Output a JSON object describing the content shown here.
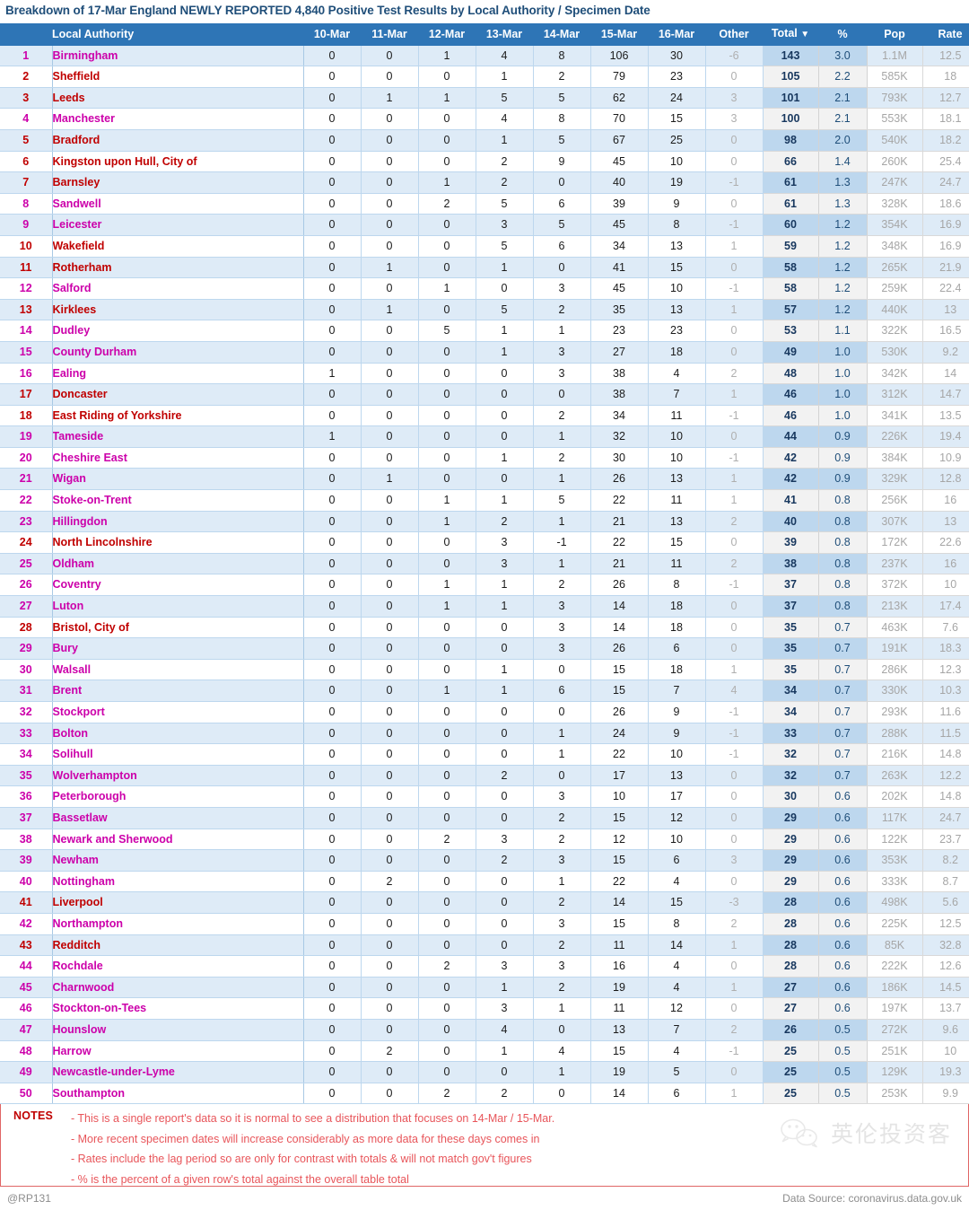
{
  "title": "Breakdown of 17-Mar England NEWLY REPORTED 4,840 Positive Test Results by Local Authority / Specimen Date",
  "table": {
    "columns": {
      "rank": "",
      "local_authority": "Local Authority",
      "days": [
        "10-Mar",
        "11-Mar",
        "12-Mar",
        "13-Mar",
        "14-Mar",
        "15-Mar",
        "16-Mar"
      ],
      "other": "Other",
      "total": "Total",
      "total_sort_icon": "▼",
      "percent": "%",
      "pop": "Pop",
      "rate": "Rate"
    },
    "rows": [
      {
        "rank": "1",
        "name": "Birmingham",
        "color": "magenta",
        "days": [
          "0",
          "0",
          "1",
          "4",
          "8",
          "106",
          "30"
        ],
        "other": "-6",
        "total": "143",
        "pct": "3.0",
        "pop": "1.1M",
        "rate": "12.5"
      },
      {
        "rank": "2",
        "name": "Sheffield",
        "color": "red",
        "days": [
          "0",
          "0",
          "0",
          "1",
          "2",
          "79",
          "23"
        ],
        "other": "0",
        "total": "105",
        "pct": "2.2",
        "pop": "585K",
        "rate": "18"
      },
      {
        "rank": "3",
        "name": "Leeds",
        "color": "red",
        "days": [
          "0",
          "1",
          "1",
          "5",
          "5",
          "62",
          "24"
        ],
        "other": "3",
        "total": "101",
        "pct": "2.1",
        "pop": "793K",
        "rate": "12.7"
      },
      {
        "rank": "4",
        "name": "Manchester",
        "color": "magenta",
        "days": [
          "0",
          "0",
          "0",
          "4",
          "8",
          "70",
          "15"
        ],
        "other": "3",
        "total": "100",
        "pct": "2.1",
        "pop": "553K",
        "rate": "18.1"
      },
      {
        "rank": "5",
        "name": "Bradford",
        "color": "red",
        "days": [
          "0",
          "0",
          "0",
          "1",
          "5",
          "67",
          "25"
        ],
        "other": "0",
        "total": "98",
        "pct": "2.0",
        "pop": "540K",
        "rate": "18.2"
      },
      {
        "rank": "6",
        "name": "Kingston upon Hull, City of",
        "color": "red",
        "days": [
          "0",
          "0",
          "0",
          "2",
          "9",
          "45",
          "10"
        ],
        "other": "0",
        "total": "66",
        "pct": "1.4",
        "pop": "260K",
        "rate": "25.4"
      },
      {
        "rank": "7",
        "name": "Barnsley",
        "color": "red",
        "days": [
          "0",
          "0",
          "1",
          "2",
          "0",
          "40",
          "19"
        ],
        "other": "-1",
        "total": "61",
        "pct": "1.3",
        "pop": "247K",
        "rate": "24.7"
      },
      {
        "rank": "8",
        "name": "Sandwell",
        "color": "magenta",
        "days": [
          "0",
          "0",
          "2",
          "5",
          "6",
          "39",
          "9"
        ],
        "other": "0",
        "total": "61",
        "pct": "1.3",
        "pop": "328K",
        "rate": "18.6"
      },
      {
        "rank": "9",
        "name": "Leicester",
        "color": "magenta",
        "days": [
          "0",
          "0",
          "0",
          "3",
          "5",
          "45",
          "8"
        ],
        "other": "-1",
        "total": "60",
        "pct": "1.2",
        "pop": "354K",
        "rate": "16.9"
      },
      {
        "rank": "10",
        "name": "Wakefield",
        "color": "red",
        "days": [
          "0",
          "0",
          "0",
          "5",
          "6",
          "34",
          "13"
        ],
        "other": "1",
        "total": "59",
        "pct": "1.2",
        "pop": "348K",
        "rate": "16.9"
      },
      {
        "rank": "11",
        "name": "Rotherham",
        "color": "red",
        "days": [
          "0",
          "1",
          "0",
          "1",
          "0",
          "41",
          "15"
        ],
        "other": "0",
        "total": "58",
        "pct": "1.2",
        "pop": "265K",
        "rate": "21.9"
      },
      {
        "rank": "12",
        "name": "Salford",
        "color": "magenta",
        "days": [
          "0",
          "0",
          "1",
          "0",
          "3",
          "45",
          "10"
        ],
        "other": "-1",
        "total": "58",
        "pct": "1.2",
        "pop": "259K",
        "rate": "22.4"
      },
      {
        "rank": "13",
        "name": "Kirklees",
        "color": "red",
        "days": [
          "0",
          "1",
          "0",
          "5",
          "2",
          "35",
          "13"
        ],
        "other": "1",
        "total": "57",
        "pct": "1.2",
        "pop": "440K",
        "rate": "13"
      },
      {
        "rank": "14",
        "name": "Dudley",
        "color": "magenta",
        "days": [
          "0",
          "0",
          "5",
          "1",
          "1",
          "23",
          "23"
        ],
        "other": "0",
        "total": "53",
        "pct": "1.1",
        "pop": "322K",
        "rate": "16.5"
      },
      {
        "rank": "15",
        "name": "County Durham",
        "color": "magenta",
        "days": [
          "0",
          "0",
          "0",
          "1",
          "3",
          "27",
          "18"
        ],
        "other": "0",
        "total": "49",
        "pct": "1.0",
        "pop": "530K",
        "rate": "9.2"
      },
      {
        "rank": "16",
        "name": "Ealing",
        "color": "magenta",
        "days": [
          "1",
          "0",
          "0",
          "0",
          "3",
          "38",
          "4"
        ],
        "other": "2",
        "total": "48",
        "pct": "1.0",
        "pop": "342K",
        "rate": "14"
      },
      {
        "rank": "17",
        "name": "Doncaster",
        "color": "red",
        "days": [
          "0",
          "0",
          "0",
          "0",
          "0",
          "38",
          "7"
        ],
        "other": "1",
        "total": "46",
        "pct": "1.0",
        "pop": "312K",
        "rate": "14.7"
      },
      {
        "rank": "18",
        "name": "East Riding of Yorkshire",
        "color": "red",
        "days": [
          "0",
          "0",
          "0",
          "0",
          "2",
          "34",
          "11"
        ],
        "other": "-1",
        "total": "46",
        "pct": "1.0",
        "pop": "341K",
        "rate": "13.5"
      },
      {
        "rank": "19",
        "name": "Tameside",
        "color": "magenta",
        "days": [
          "1",
          "0",
          "0",
          "0",
          "1",
          "32",
          "10"
        ],
        "other": "0",
        "total": "44",
        "pct": "0.9",
        "pop": "226K",
        "rate": "19.4"
      },
      {
        "rank": "20",
        "name": "Cheshire East",
        "color": "magenta",
        "days": [
          "0",
          "0",
          "0",
          "1",
          "2",
          "30",
          "10"
        ],
        "other": "-1",
        "total": "42",
        "pct": "0.9",
        "pop": "384K",
        "rate": "10.9"
      },
      {
        "rank": "21",
        "name": "Wigan",
        "color": "magenta",
        "days": [
          "0",
          "1",
          "0",
          "0",
          "1",
          "26",
          "13"
        ],
        "other": "1",
        "total": "42",
        "pct": "0.9",
        "pop": "329K",
        "rate": "12.8"
      },
      {
        "rank": "22",
        "name": "Stoke-on-Trent",
        "color": "magenta",
        "days": [
          "0",
          "0",
          "1",
          "1",
          "5",
          "22",
          "11"
        ],
        "other": "1",
        "total": "41",
        "pct": "0.8",
        "pop": "256K",
        "rate": "16"
      },
      {
        "rank": "23",
        "name": "Hillingdon",
        "color": "magenta",
        "days": [
          "0",
          "0",
          "1",
          "2",
          "1",
          "21",
          "13"
        ],
        "other": "2",
        "total": "40",
        "pct": "0.8",
        "pop": "307K",
        "rate": "13"
      },
      {
        "rank": "24",
        "name": "North Lincolnshire",
        "color": "red",
        "days": [
          "0",
          "0",
          "0",
          "3",
          "-1",
          "22",
          "15"
        ],
        "other": "0",
        "total": "39",
        "pct": "0.8",
        "pop": "172K",
        "rate": "22.6"
      },
      {
        "rank": "25",
        "name": "Oldham",
        "color": "magenta",
        "days": [
          "0",
          "0",
          "0",
          "3",
          "1",
          "21",
          "11"
        ],
        "other": "2",
        "total": "38",
        "pct": "0.8",
        "pop": "237K",
        "rate": "16"
      },
      {
        "rank": "26",
        "name": "Coventry",
        "color": "magenta",
        "days": [
          "0",
          "0",
          "1",
          "1",
          "2",
          "26",
          "8"
        ],
        "other": "-1",
        "total": "37",
        "pct": "0.8",
        "pop": "372K",
        "rate": "10"
      },
      {
        "rank": "27",
        "name": "Luton",
        "color": "magenta",
        "days": [
          "0",
          "0",
          "1",
          "1",
          "3",
          "14",
          "18"
        ],
        "other": "0",
        "total": "37",
        "pct": "0.8",
        "pop": "213K",
        "rate": "17.4"
      },
      {
        "rank": "28",
        "name": "Bristol, City of",
        "color": "red",
        "days": [
          "0",
          "0",
          "0",
          "0",
          "3",
          "14",
          "18"
        ],
        "other": "0",
        "total": "35",
        "pct": "0.7",
        "pop": "463K",
        "rate": "7.6"
      },
      {
        "rank": "29",
        "name": "Bury",
        "color": "magenta",
        "days": [
          "0",
          "0",
          "0",
          "0",
          "3",
          "26",
          "6"
        ],
        "other": "0",
        "total": "35",
        "pct": "0.7",
        "pop": "191K",
        "rate": "18.3"
      },
      {
        "rank": "30",
        "name": "Walsall",
        "color": "magenta",
        "days": [
          "0",
          "0",
          "0",
          "1",
          "0",
          "15",
          "18"
        ],
        "other": "1",
        "total": "35",
        "pct": "0.7",
        "pop": "286K",
        "rate": "12.3"
      },
      {
        "rank": "31",
        "name": "Brent",
        "color": "magenta",
        "days": [
          "0",
          "0",
          "1",
          "1",
          "6",
          "15",
          "7"
        ],
        "other": "4",
        "total": "34",
        "pct": "0.7",
        "pop": "330K",
        "rate": "10.3"
      },
      {
        "rank": "32",
        "name": "Stockport",
        "color": "magenta",
        "days": [
          "0",
          "0",
          "0",
          "0",
          "0",
          "26",
          "9"
        ],
        "other": "-1",
        "total": "34",
        "pct": "0.7",
        "pop": "293K",
        "rate": "11.6"
      },
      {
        "rank": "33",
        "name": "Bolton",
        "color": "magenta",
        "days": [
          "0",
          "0",
          "0",
          "0",
          "1",
          "24",
          "9"
        ],
        "other": "-1",
        "total": "33",
        "pct": "0.7",
        "pop": "288K",
        "rate": "11.5"
      },
      {
        "rank": "34",
        "name": "Solihull",
        "color": "magenta",
        "days": [
          "0",
          "0",
          "0",
          "0",
          "1",
          "22",
          "10"
        ],
        "other": "-1",
        "total": "32",
        "pct": "0.7",
        "pop": "216K",
        "rate": "14.8"
      },
      {
        "rank": "35",
        "name": "Wolverhampton",
        "color": "magenta",
        "days": [
          "0",
          "0",
          "0",
          "2",
          "0",
          "17",
          "13"
        ],
        "other": "0",
        "total": "32",
        "pct": "0.7",
        "pop": "263K",
        "rate": "12.2"
      },
      {
        "rank": "36",
        "name": "Peterborough",
        "color": "magenta",
        "days": [
          "0",
          "0",
          "0",
          "0",
          "3",
          "10",
          "17"
        ],
        "other": "0",
        "total": "30",
        "pct": "0.6",
        "pop": "202K",
        "rate": "14.8"
      },
      {
        "rank": "37",
        "name": "Bassetlaw",
        "color": "magenta",
        "days": [
          "0",
          "0",
          "0",
          "0",
          "2",
          "15",
          "12"
        ],
        "other": "0",
        "total": "29",
        "pct": "0.6",
        "pop": "117K",
        "rate": "24.7"
      },
      {
        "rank": "38",
        "name": "Newark and Sherwood",
        "color": "magenta",
        "days": [
          "0",
          "0",
          "2",
          "3",
          "2",
          "12",
          "10"
        ],
        "other": "0",
        "total": "29",
        "pct": "0.6",
        "pop": "122K",
        "rate": "23.7"
      },
      {
        "rank": "39",
        "name": "Newham",
        "color": "magenta",
        "days": [
          "0",
          "0",
          "0",
          "2",
          "3",
          "15",
          "6"
        ],
        "other": "3",
        "total": "29",
        "pct": "0.6",
        "pop": "353K",
        "rate": "8.2"
      },
      {
        "rank": "40",
        "name": "Nottingham",
        "color": "magenta",
        "days": [
          "0",
          "2",
          "0",
          "0",
          "1",
          "22",
          "4"
        ],
        "other": "0",
        "total": "29",
        "pct": "0.6",
        "pop": "333K",
        "rate": "8.7"
      },
      {
        "rank": "41",
        "name": "Liverpool",
        "color": "red",
        "days": [
          "0",
          "0",
          "0",
          "0",
          "2",
          "14",
          "15"
        ],
        "other": "-3",
        "total": "28",
        "pct": "0.6",
        "pop": "498K",
        "rate": "5.6"
      },
      {
        "rank": "42",
        "name": "Northampton",
        "color": "magenta",
        "days": [
          "0",
          "0",
          "0",
          "0",
          "3",
          "15",
          "8"
        ],
        "other": "2",
        "total": "28",
        "pct": "0.6",
        "pop": "225K",
        "rate": "12.5"
      },
      {
        "rank": "43",
        "name": "Redditch",
        "color": "red",
        "days": [
          "0",
          "0",
          "0",
          "0",
          "2",
          "11",
          "14"
        ],
        "other": "1",
        "total": "28",
        "pct": "0.6",
        "pop": "85K",
        "rate": "32.8"
      },
      {
        "rank": "44",
        "name": "Rochdale",
        "color": "magenta",
        "days": [
          "0",
          "0",
          "2",
          "3",
          "3",
          "16",
          "4"
        ],
        "other": "0",
        "total": "28",
        "pct": "0.6",
        "pop": "222K",
        "rate": "12.6"
      },
      {
        "rank": "45",
        "name": "Charnwood",
        "color": "magenta",
        "days": [
          "0",
          "0",
          "0",
          "1",
          "2",
          "19",
          "4"
        ],
        "other": "1",
        "total": "27",
        "pct": "0.6",
        "pop": "186K",
        "rate": "14.5"
      },
      {
        "rank": "46",
        "name": "Stockton-on-Tees",
        "color": "magenta",
        "days": [
          "0",
          "0",
          "0",
          "3",
          "1",
          "11",
          "12"
        ],
        "other": "0",
        "total": "27",
        "pct": "0.6",
        "pop": "197K",
        "rate": "13.7"
      },
      {
        "rank": "47",
        "name": "Hounslow",
        "color": "magenta",
        "days": [
          "0",
          "0",
          "0",
          "4",
          "0",
          "13",
          "7"
        ],
        "other": "2",
        "total": "26",
        "pct": "0.5",
        "pop": "272K",
        "rate": "9.6"
      },
      {
        "rank": "48",
        "name": "Harrow",
        "color": "magenta",
        "days": [
          "0",
          "2",
          "0",
          "1",
          "4",
          "15",
          "4"
        ],
        "other": "-1",
        "total": "25",
        "pct": "0.5",
        "pop": "251K",
        "rate": "10"
      },
      {
        "rank": "49",
        "name": "Newcastle-under-Lyme",
        "color": "magenta",
        "days": [
          "0",
          "0",
          "0",
          "0",
          "1",
          "19",
          "5"
        ],
        "other": "0",
        "total": "25",
        "pct": "0.5",
        "pop": "129K",
        "rate": "19.3"
      },
      {
        "rank": "50",
        "name": "Southampton",
        "color": "magenta",
        "days": [
          "0",
          "0",
          "2",
          "2",
          "0",
          "14",
          "6"
        ],
        "other": "1",
        "total": "25",
        "pct": "0.5",
        "pop": "253K",
        "rate": "9.9"
      }
    ]
  },
  "notes": {
    "label": "NOTES",
    "lines": [
      "- This is a single report's data so it is normal to see a distribution that focuses on 14-Mar / 15-Mar.",
      "- More recent specimen dates will increase considerably as more data for these days comes in",
      "- Rates include the lag period so are only for contrast with totals & will not match gov't figures",
      "- % is the percent of a given row's total against the overall table total"
    ]
  },
  "watermark": {
    "text": "英伦投资客",
    "icon": "wechat-icon"
  },
  "footer": {
    "left": "@RP131",
    "right": "Data Source: coronavirus.data.gov.uk"
  },
  "colors": {
    "header_blue": "#2E75B6",
    "title_blue": "#1F4E79",
    "band_blue": "#DEEBF7",
    "total_blue": "#BDD7EE",
    "name_magenta": "#CC00AA",
    "name_red": "#C00000",
    "notes_red": "#E8555A"
  }
}
